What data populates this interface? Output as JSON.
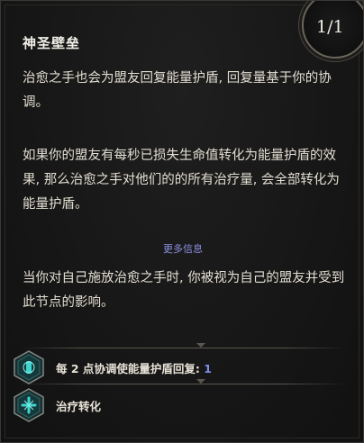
{
  "tooltip": {
    "title": "神圣壁垒",
    "counter": "1/1",
    "paragraph1": "治愈之手也会为盟友回复能量护盾, 回复量基于你的协调。",
    "paragraph2": "如果你的盟友有每秒已损失生命值转化为能量护盾的效果, 那么治愈之手对他们的的所有治疗量, 会全部转化为能量护盾。",
    "more_info": "更多信息",
    "paragraph3": "当你对自己施放治愈之手时, 你被视为自己的盟友并受到此节点的影响。"
  },
  "nodes": [
    {
      "label": "每 2 点协调使能量护盾回复: ",
      "value": "1",
      "icon": "shield-rune-icon"
    },
    {
      "label": "治疗转化",
      "icon": "cross-rune-icon"
    }
  ],
  "colors": {
    "accent_value": "#7d8fe8",
    "more_info": "#8b8fe0",
    "icon_teal": "#3fd6d0"
  }
}
